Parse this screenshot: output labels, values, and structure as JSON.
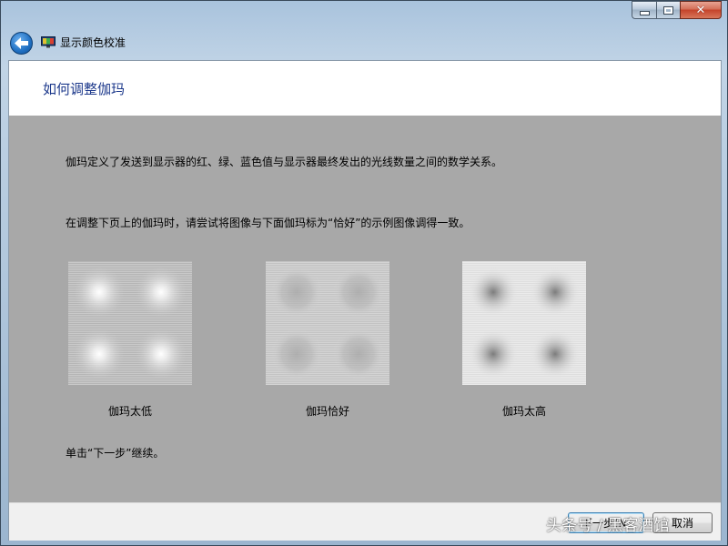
{
  "window": {
    "title": "显示颜色校准",
    "controls": {
      "minimize": "minimize-icon",
      "maximize": "maximize-icon",
      "close": "close-icon"
    }
  },
  "page": {
    "heading": "如何调整伽玛",
    "paragraph1": "伽玛定义了发送到显示器的红、绿、蓝色值与显示器最终发出的光线数量之间的数学关系。",
    "paragraph2": "在调整下页上的伽玛时，请尝试将图像与下面伽玛标为“恰好”的示例图像调得一致。",
    "instruction": "单击“下一步”继续。"
  },
  "samples": [
    {
      "caption": "伽玛太低"
    },
    {
      "caption": "伽玛恰好"
    },
    {
      "caption": "伽玛太高"
    }
  ],
  "buttons": {
    "next": "下一步(N)",
    "cancel": "取消"
  },
  "watermark": "头条号 / 黑客酒馆",
  "colors": {
    "heading": "#1e3a8c",
    "content_background": "#a8a8a8"
  }
}
